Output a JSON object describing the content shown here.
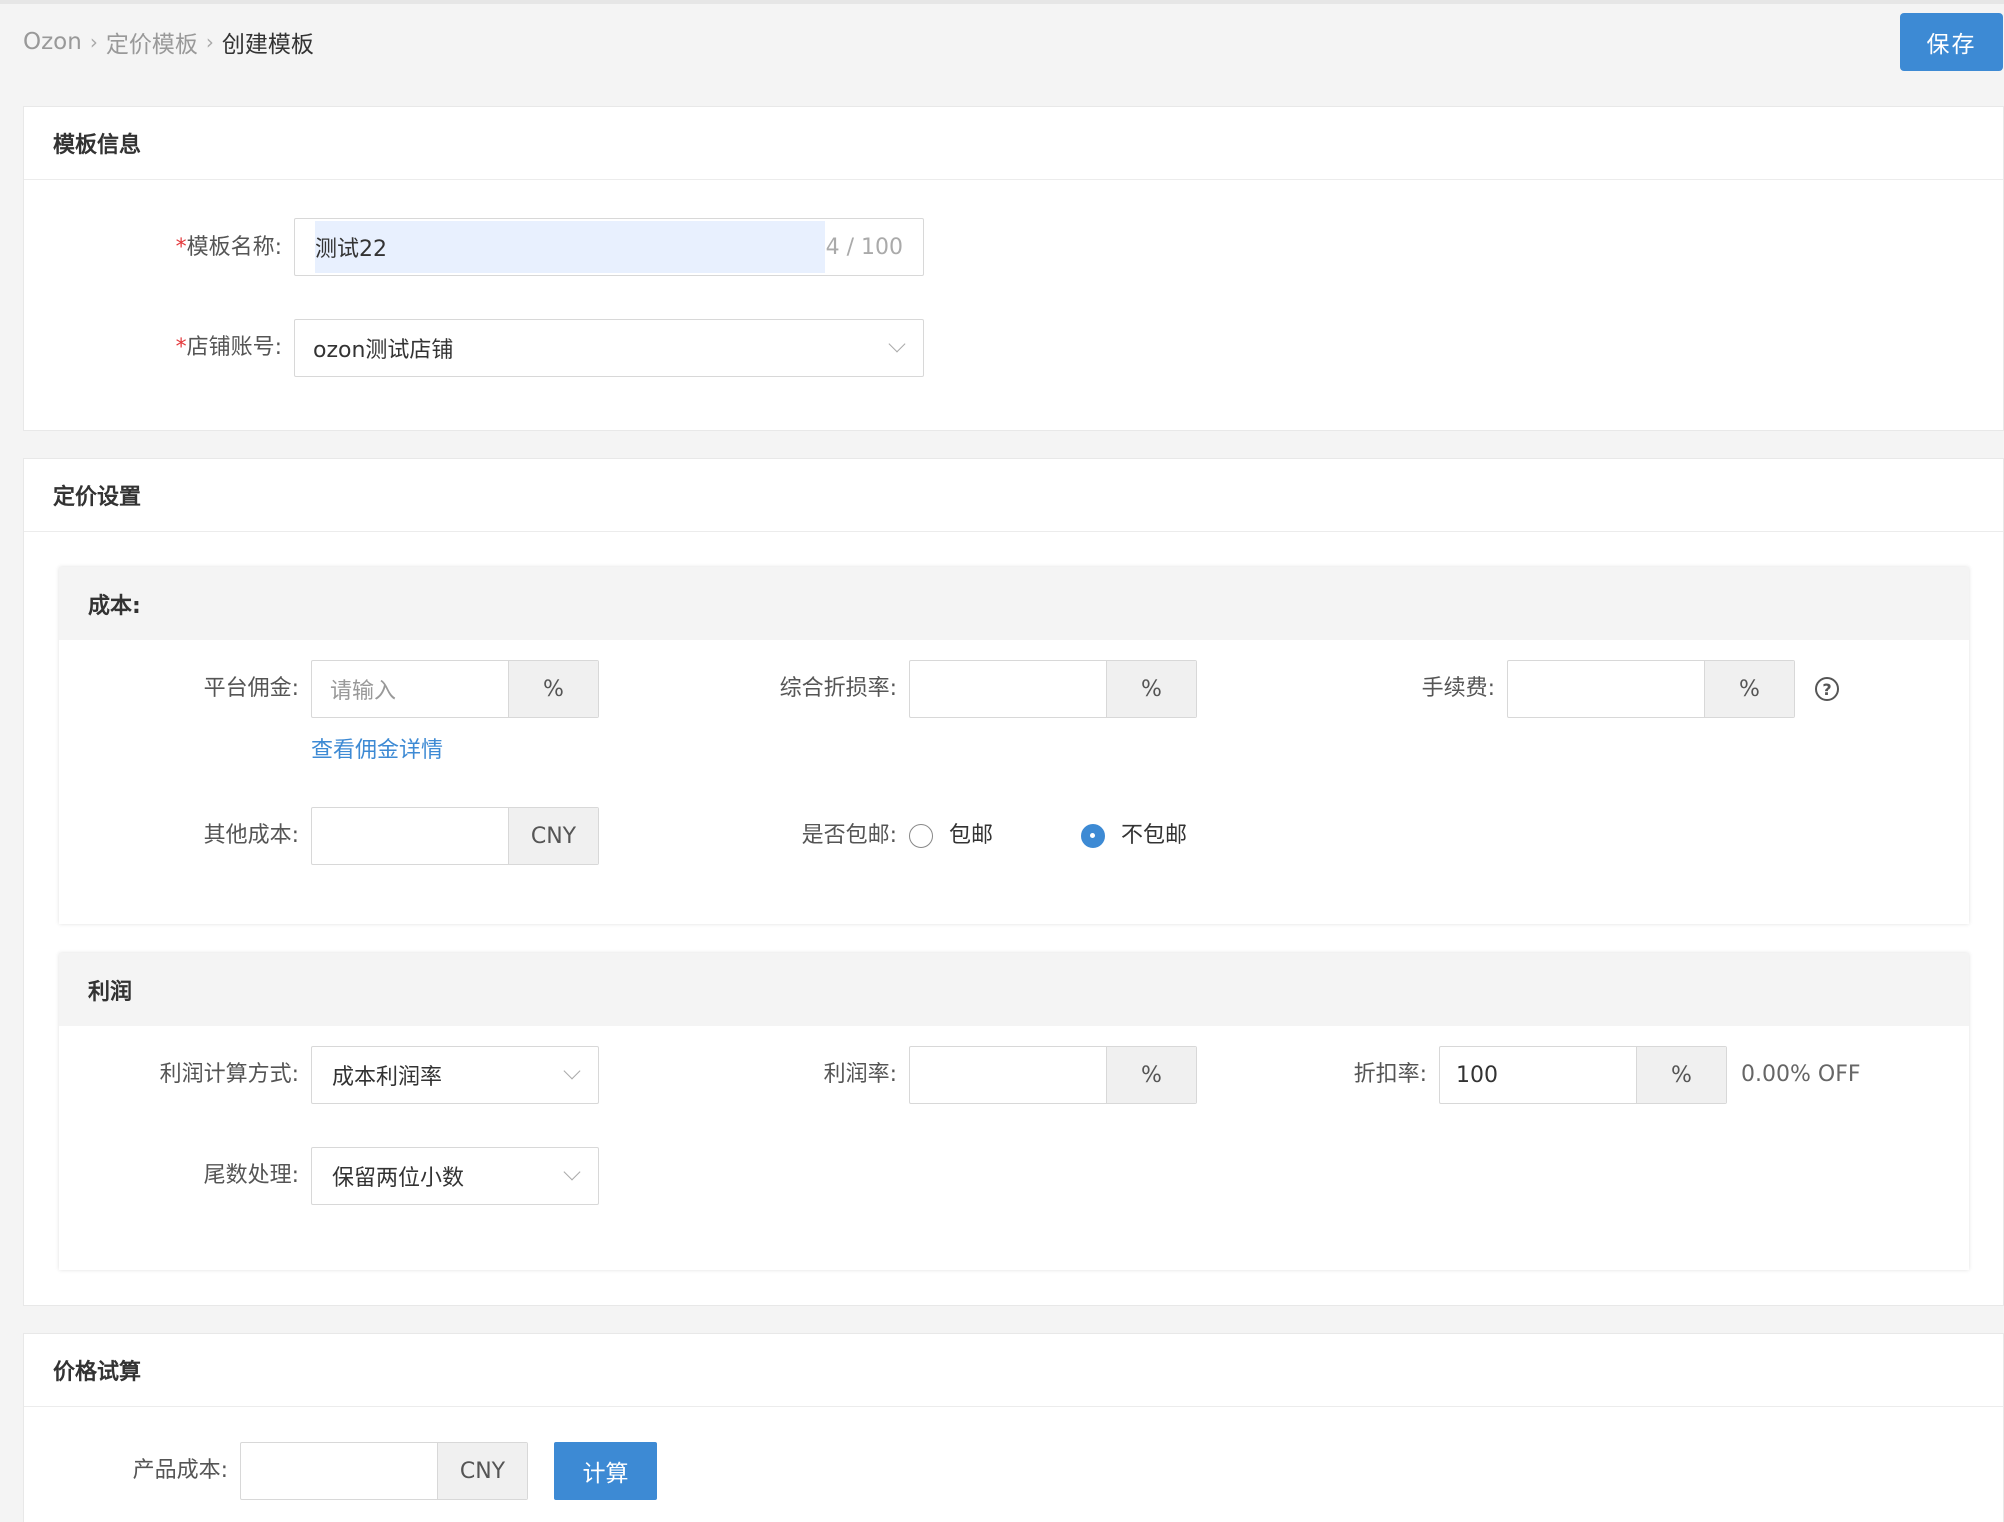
{
  "breadcrumb": {
    "root": "Ozon",
    "level1": "定价模板",
    "current": "创建模板"
  },
  "header": {
    "save_label": "保存"
  },
  "template_info": {
    "title": "模板信息",
    "name_label": "模板名称:",
    "name_value": "测试22",
    "name_counter": "4 / 100",
    "shop_label": "店铺账号:",
    "shop_value": "ozon测试店铺"
  },
  "pricing": {
    "title": "定价设置",
    "cost": {
      "title": "成本:",
      "commission_label": "平台佣金:",
      "commission_placeholder": "请输入",
      "commission_unit": "%",
      "commission_link": "查看佣金详情",
      "loss_rate_label": "综合折损率:",
      "loss_rate_unit": "%",
      "fee_label": "手续费:",
      "fee_unit": "%",
      "other_cost_label": "其他成本:",
      "other_cost_unit": "CNY",
      "shipping_label": "是否包邮:",
      "shipping_options": [
        "包邮",
        "不包邮"
      ],
      "shipping_selected": "不包邮"
    },
    "profit": {
      "title": "利润",
      "method_label": "利润计算方式:",
      "method_value": "成本利润率",
      "rate_label": "利润率:",
      "rate_unit": "%",
      "discount_label": "折扣率:",
      "discount_value": "100",
      "discount_unit": "%",
      "discount_off": "0.00% OFF",
      "rounding_label": "尾数处理:",
      "rounding_value": "保留两位小数"
    }
  },
  "trial": {
    "title": "价格试算",
    "cost_label": "产品成本:",
    "cost_unit": "CNY",
    "calc_label": "计算"
  }
}
